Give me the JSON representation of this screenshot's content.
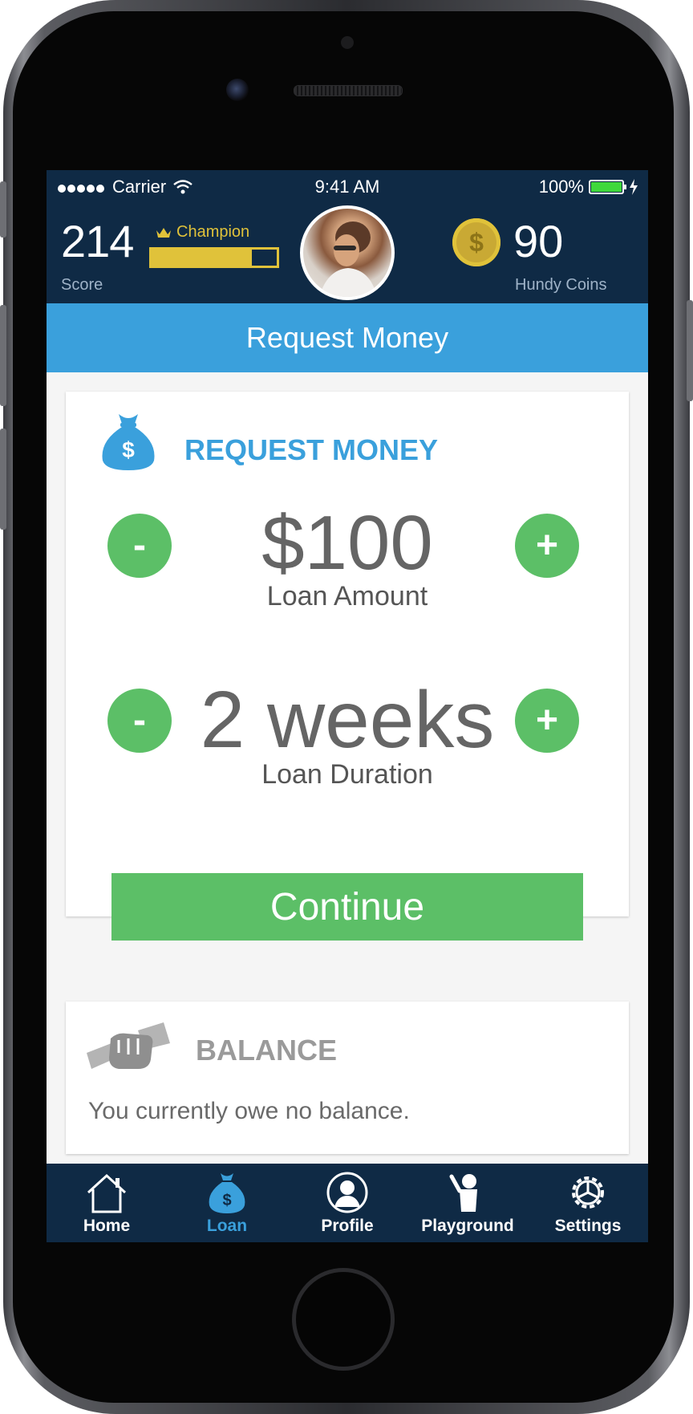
{
  "status_bar": {
    "carrier": "Carrier",
    "time": "9:41 AM",
    "battery_percent": "100%",
    "battery_level": 1.0
  },
  "header": {
    "score_value": "214",
    "score_label": "Score",
    "rank_label": "Champion",
    "rank_progress": 0.8,
    "coins_value": "90",
    "coins_label": "Hundy Coins",
    "coin_symbol": "$"
  },
  "page_title": "Request Money",
  "request_card": {
    "heading": "REQUEST MONEY",
    "amount_value": "$100",
    "amount_label": "Loan Amount",
    "duration_value": "2 weeks",
    "duration_label": "Loan Duration",
    "minus_symbol": "-",
    "plus_symbol": "+",
    "continue_label": "Continue"
  },
  "balance_card": {
    "heading": "BALANCE",
    "message": "You  currently owe no balance."
  },
  "tab_bar": {
    "tabs": [
      {
        "label": "Home",
        "icon": "home-icon"
      },
      {
        "label": "Loan",
        "icon": "money-bag-icon",
        "active": true
      },
      {
        "label": "Profile",
        "icon": "profile-icon"
      },
      {
        "label": "Playground",
        "icon": "playground-icon"
      },
      {
        "label": "Settings",
        "icon": "gear-icon"
      }
    ]
  },
  "colors": {
    "navy": "#0f2a45",
    "blue": "#3aa0dc",
    "green": "#5cbf67",
    "gold": "#e0c23a"
  }
}
